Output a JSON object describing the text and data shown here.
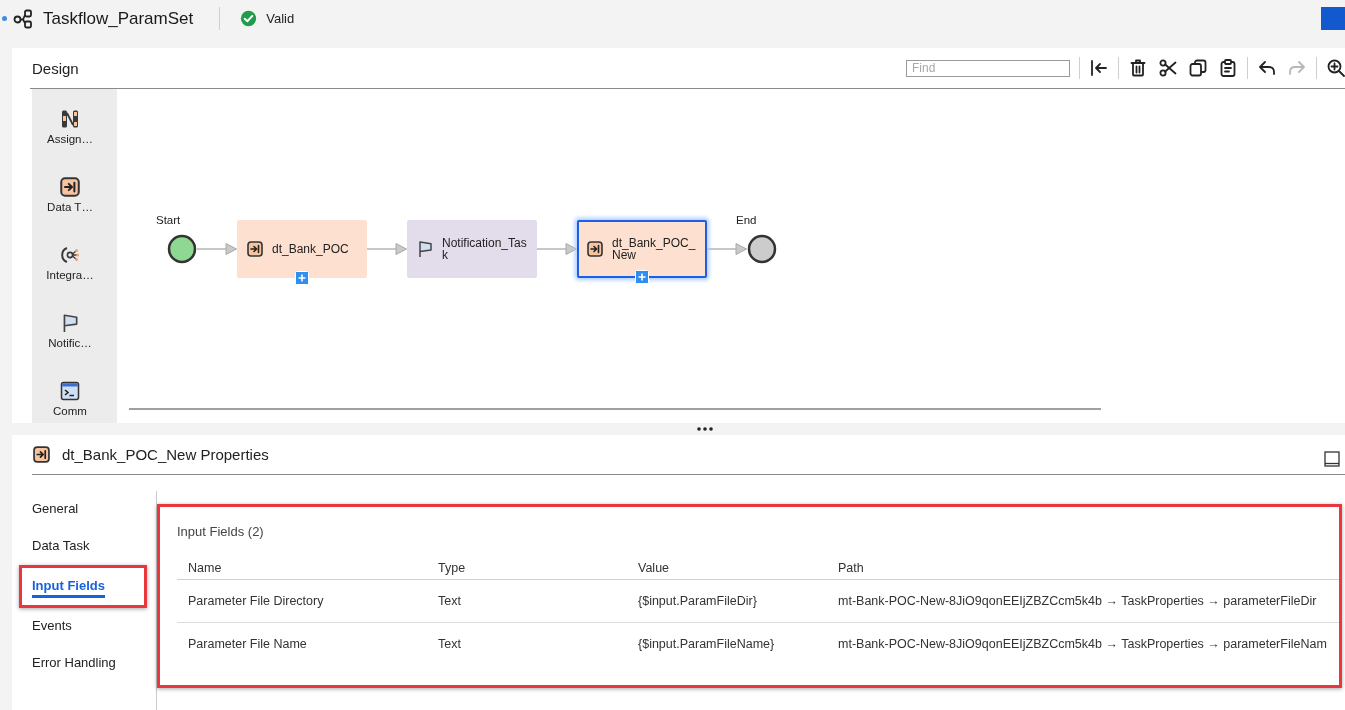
{
  "header": {
    "indicator": true,
    "title": "Taskflow_ParamSet",
    "status": {
      "label": "Valid",
      "valid": true
    }
  },
  "design": {
    "title": "Design",
    "find": {
      "placeholder": "Find"
    },
    "toolbar_groups": [
      {
        "buttons": [
          {
            "kind": "collapse",
            "disabled": false
          }
        ]
      },
      {
        "buttons": [
          {
            "kind": "delete",
            "disabled": false
          },
          {
            "kind": "cut",
            "disabled": false
          },
          {
            "kind": "copy",
            "disabled": false
          },
          {
            "kind": "paste",
            "disabled": false
          }
        ]
      },
      {
        "buttons": [
          {
            "kind": "undo",
            "disabled": false
          },
          {
            "kind": "redo",
            "disabled": true
          }
        ]
      },
      {
        "buttons": [
          {
            "kind": "zoom-in",
            "disabled": false
          }
        ]
      }
    ],
    "palette": [
      {
        "kind": "assignment",
        "label": "Assign…"
      },
      {
        "kind": "data-task",
        "label": "Data T…"
      },
      {
        "kind": "integration",
        "label": "Integra…"
      },
      {
        "kind": "notification",
        "label": "Notific…"
      },
      {
        "kind": "command",
        "label": "Comm"
      }
    ],
    "canvas": {
      "nodes": [
        {
          "kind": "start",
          "label": "Start",
          "selected": false
        },
        {
          "kind": "data-task",
          "label": "dt_Bank_POC",
          "selected": false,
          "add_button": true
        },
        {
          "kind": "notification",
          "label": "Notification_Task",
          "selected": false,
          "add_button": false
        },
        {
          "kind": "data-task",
          "label": "dt_Bank_POC_New",
          "selected": true,
          "add_button": true
        },
        {
          "kind": "end",
          "label": "End",
          "selected": false
        }
      ]
    }
  },
  "properties": {
    "kind": "data-task",
    "title": "dt_Bank_POC_New Properties",
    "nav": [
      {
        "label": "General",
        "selected": false,
        "highlighted": false
      },
      {
        "label": "Data Task",
        "selected": false,
        "highlighted": false
      },
      {
        "label": "Input Fields",
        "selected": true,
        "highlighted": true
      },
      {
        "label": "Events",
        "selected": false,
        "highlighted": false
      },
      {
        "label": "Error Handling",
        "selected": false,
        "highlighted": false
      }
    ],
    "input_fields": {
      "title": "Input Fields (2)",
      "highlighted": true,
      "columns": [
        "Name",
        "Type",
        "Value",
        "Path"
      ],
      "rows": [
        [
          "Parameter File Directory",
          "Text",
          "{$input.ParamFileDir}",
          "mt-Bank-POC-New-8JiO9qonEEIjZBZCcm5k4b → TaskProperties → parameterFileDir"
        ],
        [
          "Parameter File Name",
          "Text",
          "{$input.ParamFileName}",
          "mt-Bank-POC-New-8JiO9qonEEIjZBZCcm5k4b → TaskProperties → parameterFileNam"
        ]
      ]
    }
  }
}
